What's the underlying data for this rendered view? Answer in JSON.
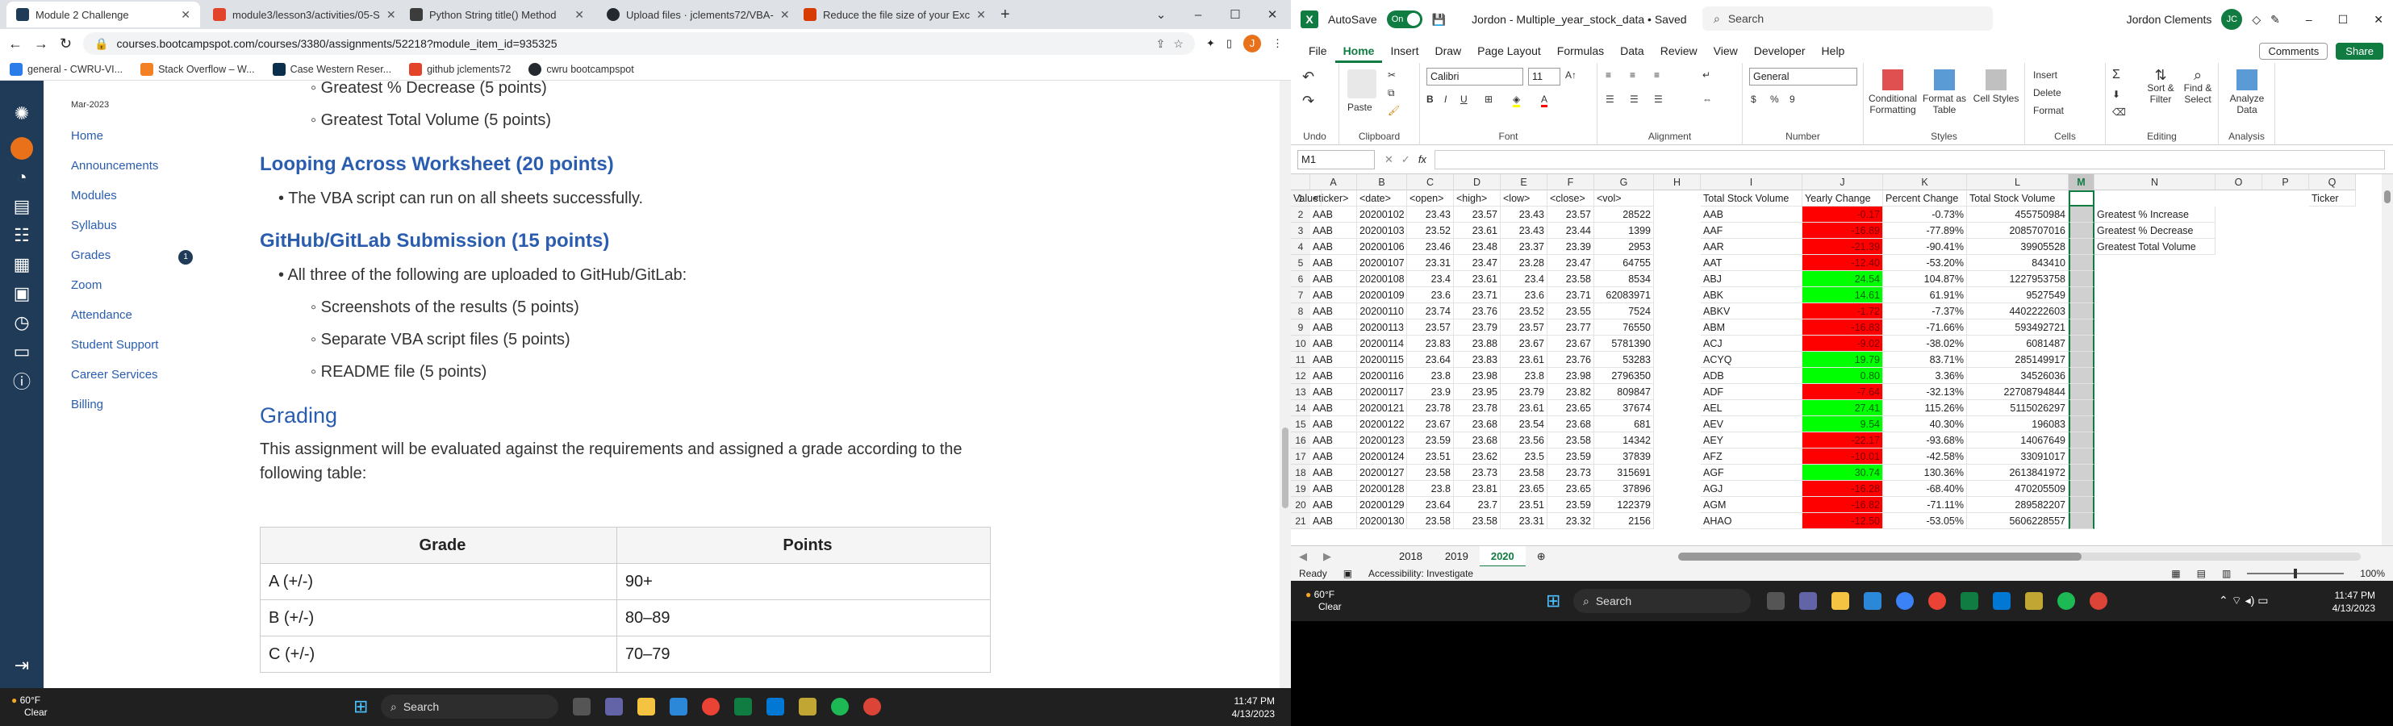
{
  "browser": {
    "tabs": [
      {
        "title": "Module 2 Challenge",
        "color": "#1f3b57"
      },
      {
        "title": "module3/lesson3/activities/05-S",
        "color": "#e24329"
      },
      {
        "title": "Python String title() Method",
        "color": "#3c3c3c"
      },
      {
        "title": "Upload files · jclements72/VBA-",
        "color": "#24292f"
      },
      {
        "title": "Reduce the file size of your Exc",
        "color": "#d83b01"
      }
    ],
    "new_tab": "+",
    "url": "courses.bootcampspot.com/courses/3380/assignments/52218?module_item_id=935325",
    "profile_initial": "J",
    "bookmarks": [
      "general - CWRU-VI...",
      "Stack Overflow – W...",
      "Case Western Reser...",
      "github jclements72",
      "cwru bootcampspot"
    ]
  },
  "course_nav": {
    "term": "Mar-2023",
    "links": [
      "Home",
      "Announcements",
      "Modules",
      "Syllabus",
      "Grades",
      "Zoom",
      "Attendance",
      "Student Support",
      "Career Services",
      "Billing"
    ],
    "grades_badge": "1"
  },
  "content": {
    "bullet_top_1": "Greatest % Decrease (5 points)",
    "bullet_top_2": "Greatest Total Volume (5 points)",
    "heading_looping": "Looping Across Worksheet (20 points)",
    "looping_bullet": "The VBA script can run on all sheets successfully.",
    "heading_github": "GitHub/GitLab Submission (15 points)",
    "github_bullet": "All three of the following are uploaded to GitHub/GitLab:",
    "sub_1": "Screenshots of the results (5 points)",
    "sub_2": "Separate VBA script files (5 points)",
    "sub_3": "README file (5 points)",
    "heading_grading": "Grading",
    "grading_text_1": "This assignment will be evaluated against the requirements and assigned a grade according to the",
    "grading_text_2": "following table:",
    "table_headers": [
      "Grade",
      "Points"
    ],
    "table_rows": [
      [
        "A (+/-)",
        "90+"
      ],
      [
        "B (+/-)",
        "80–89"
      ],
      [
        "C (+/-)",
        "70–79"
      ]
    ]
  },
  "taskbar_left": {
    "temp": "60°F",
    "weather": "Clear",
    "search": "Search",
    "time": "11:47 PM",
    "date": "4/13/2023"
  },
  "excel": {
    "autosave": "AutoSave",
    "toggle": "On",
    "file_title": "Jordon - Multiple_year_stock_data • Saved",
    "search": "Search",
    "user": "Jordon Clements",
    "user_initials": "JC",
    "menu": [
      "File",
      "Home",
      "Insert",
      "Draw",
      "Page Layout",
      "Formulas",
      "Data",
      "Review",
      "View",
      "Developer",
      "Help"
    ],
    "comments": "Comments",
    "share": "Share",
    "ribbon": {
      "undo": "Undo",
      "clipboard": "Clipboard",
      "paste": "Paste",
      "font": "Calibri",
      "size": "11",
      "font_group": "Font",
      "alignment": "Alignment",
      "number_format": "General",
      "number": "Number",
      "conditional": "Conditional Formatting",
      "format_table": "Format as Table",
      "cell_styles": "Cell Styles",
      "styles": "Styles",
      "insert": "Insert",
      "delete": "Delete",
      "format": "Format",
      "cells": "Cells",
      "sort": "Sort & Filter",
      "find": "Find & Select",
      "editing": "Editing",
      "analyze": "Analyze Data",
      "analysis": "Analysis"
    },
    "namebox": "M1",
    "columns": [
      "A",
      "B",
      "C",
      "D",
      "E",
      "F",
      "G",
      "H",
      "I",
      "J",
      "K",
      "L",
      "M",
      "N",
      "O",
      "P",
      "Q"
    ],
    "headers": [
      "<ticker>",
      "<date>",
      "<open>",
      "<high>",
      "<low>",
      "<close>",
      "<vol>",
      "",
      "Total Stock Volume",
      "Yearly Change",
      "Percent Change",
      "Total Stock Volume",
      "",
      "",
      "Ticker",
      "Value"
    ],
    "labels_n": [
      "Greatest % Increase",
      "Greatest % Decrease",
      "Greatest Total Volume"
    ],
    "rows": [
      [
        "AAB",
        "20200102",
        "23.43",
        "23.57",
        "23.43",
        "23.57",
        "28522",
        "AAB",
        "-0.17",
        "-0.73%",
        "455750984"
      ],
      [
        "AAB",
        "20200103",
        "23.52",
        "23.61",
        "23.43",
        "23.44",
        "1399",
        "AAF",
        "-16.89",
        "-77.89%",
        "2085707016"
      ],
      [
        "AAB",
        "20200106",
        "23.46",
        "23.48",
        "23.37",
        "23.39",
        "2953",
        "AAR",
        "-21.39",
        "-90.41%",
        "39905528"
      ],
      [
        "AAB",
        "20200107",
        "23.31",
        "23.47",
        "23.28",
        "23.47",
        "64755",
        "AAT",
        "-12.40",
        "-53.20%",
        "843410"
      ],
      [
        "AAB",
        "20200108",
        "23.4",
        "23.61",
        "23.4",
        "23.58",
        "8534",
        "ABJ",
        "24.54",
        "104.87%",
        "1227953758"
      ],
      [
        "AAB",
        "20200109",
        "23.6",
        "23.71",
        "23.6",
        "23.71",
        "62083971",
        "ABK",
        "14.61",
        "61.91%",
        "9527549"
      ],
      [
        "AAB",
        "20200110",
        "23.74",
        "23.76",
        "23.52",
        "23.55",
        "7524",
        "ABKV",
        "-1.72",
        "-7.37%",
        "4402222603"
      ],
      [
        "AAB",
        "20200113",
        "23.57",
        "23.79",
        "23.57",
        "23.77",
        "76550",
        "ABM",
        "-16.83",
        "-71.66%",
        "593492721"
      ],
      [
        "AAB",
        "20200114",
        "23.83",
        "23.88",
        "23.67",
        "23.67",
        "5781390",
        "ACJ",
        "-9.02",
        "-38.02%",
        "6081487"
      ],
      [
        "AAB",
        "20200115",
        "23.64",
        "23.83",
        "23.61",
        "23.76",
        "53283",
        "ACYQ",
        "19.79",
        "83.71%",
        "285149917"
      ],
      [
        "AAB",
        "20200116",
        "23.8",
        "23.98",
        "23.8",
        "23.98",
        "2796350",
        "ADB",
        "0.80",
        "3.36%",
        "34526036"
      ],
      [
        "AAB",
        "20200117",
        "23.9",
        "23.95",
        "23.79",
        "23.82",
        "809847",
        "ADF",
        "-7.64",
        "-32.13%",
        "22708794844"
      ],
      [
        "AAB",
        "20200121",
        "23.78",
        "23.78",
        "23.61",
        "23.65",
        "37674",
        "AEL",
        "27.41",
        "115.26%",
        "5115026297"
      ],
      [
        "AAB",
        "20200122",
        "23.67",
        "23.68",
        "23.54",
        "23.68",
        "681",
        "AEV",
        "9.54",
        "40.30%",
        "196083"
      ],
      [
        "AAB",
        "20200123",
        "23.59",
        "23.68",
        "23.56",
        "23.58",
        "14342",
        "AEY",
        "-22.17",
        "-93.68%",
        "14067649"
      ],
      [
        "AAB",
        "20200124",
        "23.51",
        "23.62",
        "23.5",
        "23.59",
        "37839",
        "AFZ",
        "-10.01",
        "-42.58%",
        "33091017"
      ],
      [
        "AAB",
        "20200127",
        "23.58",
        "23.73",
        "23.58",
        "23.73",
        "315691",
        "AGF",
        "30.74",
        "130.36%",
        "2613841972"
      ],
      [
        "AAB",
        "20200128",
        "23.8",
        "23.81",
        "23.65",
        "23.65",
        "37896",
        "AGJ",
        "-16.28",
        "-68.40%",
        "470205509"
      ],
      [
        "AAB",
        "20200129",
        "23.64",
        "23.7",
        "23.51",
        "23.59",
        "122379",
        "AGM",
        "-16.82",
        "-71.11%",
        "289582207"
      ],
      [
        "AAB",
        "20200130",
        "23.58",
        "23.58",
        "23.31",
        "23.32",
        "2156",
        "AHAO",
        "-12.50",
        "-53.05%",
        "5606228557"
      ]
    ],
    "sheets": [
      "2018",
      "2019",
      "2020"
    ],
    "status": "Ready",
    "accessibility": "Accessibility: Investigate",
    "zoom": "100%"
  },
  "taskbar_right": {
    "temp": "60°F",
    "weather": "Clear",
    "search": "Search",
    "time": "11:47 PM",
    "date": "4/13/2023"
  }
}
